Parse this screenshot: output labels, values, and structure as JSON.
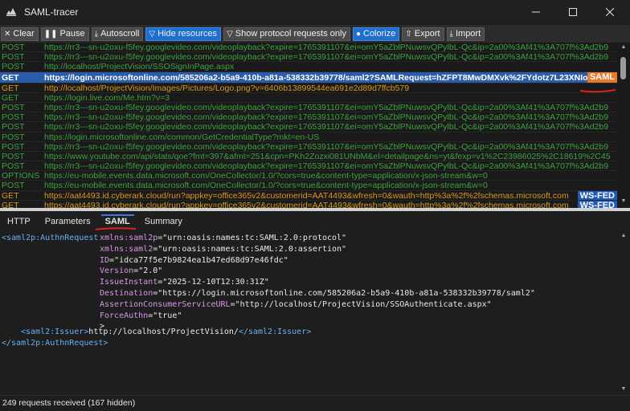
{
  "window": {
    "title": "SAML-tracer",
    "controls": {
      "minimize": "—",
      "maximize": "☐",
      "close": "✕"
    }
  },
  "toolbar": {
    "clear": "Clear",
    "pause": "Pause",
    "autoscroll": "Autoscroll",
    "hide_resources": "Hide resources",
    "show_protocol": "Show protocol requests only",
    "colorize": "Colorize",
    "export": "Export",
    "import": "Import"
  },
  "requests": [
    {
      "method": "POST",
      "url": "https://rr3---sn-u2oxu-f5fey.googlevideo.com/videoplayback?expire=1765391107&ei=omY5aZblPNuwsvQPylbL-Qc&ip=2a00%3Af41%3A707f%3Ad2b9",
      "style": "post"
    },
    {
      "method": "POST",
      "url": "https://rr3---sn-u2oxu-f5fey.googlevideo.com/videoplayback?expire=1765391107&ei=omY5aZblPNuwsvQPylbL-Qc&ip=2a00%3Af41%3A707f%3Ad2b9",
      "style": "post"
    },
    {
      "method": "POST",
      "url": "http://localhost/ProjectVision/SSOSignInPage.aspx",
      "style": "post"
    },
    {
      "method": "GET",
      "url": "https://login.microsoftonline.com/585206a2-b5a9-410b-a81a-538332b39778/saml2?SAMLRequest=hZFPT8MwDMXvk%2FYdotz7L23XNIonTU",
      "style": "sel",
      "tag": "SAML"
    },
    {
      "method": "GET",
      "url": "http://localhost/ProjectVision/Images/Pictures/Logo.png?v=6406b13899544ea691e2d89d7ffcb579",
      "style": "get-orange"
    },
    {
      "method": "GET",
      "url": "https://login.live.com/Me.htm?v=3",
      "style": "get-green"
    },
    {
      "method": "POST",
      "url": "https://rr3---sn-u2oxu-f5fey.googlevideo.com/videoplayback?expire=1765391107&ei=omY5aZblPNuwsvQPylbL-Qc&ip=2a00%3Af41%3A707f%3Ad2b9",
      "style": "post"
    },
    {
      "method": "POST",
      "url": "https://rr3---sn-u2oxu-f5fey.googlevideo.com/videoplayback?expire=1765391107&ei=omY5aZblPNuwsvQPylbL-Qc&ip=2a00%3Af41%3A707f%3Ad2b9",
      "style": "post"
    },
    {
      "method": "POST",
      "url": "https://rr3---sn-u2oxu-f5fey.googlevideo.com/videoplayback?expire=1765391107&ei=omY5aZblPNuwsvQPylbL-Qc&ip=2a00%3Af41%3A707f%3Ad2b9",
      "style": "post"
    },
    {
      "method": "POST",
      "url": "https://login.microsoftonline.com/common/GetCredentialType?mkt=en-US",
      "style": "post"
    },
    {
      "method": "POST",
      "url": "https://rr3---sn-u2oxu-f5fey.googlevideo.com/videoplayback?expire=1765391107&ei=omY5aZblPNuwsvQPylbL-Qc&ip=2a00%3Af41%3A707f%3Ad2b9",
      "style": "post"
    },
    {
      "method": "POST",
      "url": "https://www.youtube.com/api/stats/qoe?fmt=397&afmt=251&cpn=PKh2Zozxi081UNbM&el=detailpage&ns=yt&fexp=v1%2C23986025%2C18619%2C45",
      "style": "post"
    },
    {
      "method": "POST",
      "url": "https://rr3---sn-u2oxu-f5fey.googlevideo.com/videoplayback?expire=1765391107&ei=omY5aZblPNuwsvQPylbL-Qc&ip=2a00%3Af41%3A707f%3Ad2b9",
      "style": "post"
    },
    {
      "method": "OPTIONS",
      "url": "https://eu-mobile.events.data.microsoft.com/OneCollector/1.0/?cors=true&content-type=application/x-json-stream&w=0",
      "style": "opt"
    },
    {
      "method": "POST",
      "url": "https://eu-mobile.events.data.microsoft.com/OneCollector/1.0/?cors=true&content-type=application/x-json-stream&w=0",
      "style": "post"
    },
    {
      "method": "GET",
      "url": "https://aat4493.id.cyberark.cloud/run?appkey=office365v2&customerid=AAT4493&wfresh=0&wauth=http%3a%2f%2fschemas.microsoft.com",
      "style": "get-orange",
      "tag": "WS-FED"
    },
    {
      "method": "GET",
      "url": "https://aat4493.id.cyberark.cloud/run?appkey=office365v2&customerid=AAT4493&wfresh=0&wauth=http%3a%2f%2fschemas.microsoft.com",
      "style": "get-orange",
      "tag": "WS-FED"
    }
  ],
  "tabs": {
    "http": "HTTP",
    "parameters": "Parameters",
    "saml": "SAML",
    "summary": "Summary"
  },
  "xml": {
    "open_tag": "<saml2p:AuthnRequest",
    "attrs": [
      {
        "name": "xmlns:saml2p",
        "value": "\"urn:oasis:names:tc:SAML:2.0:protocol\""
      },
      {
        "name": "xmlns:saml2",
        "value": "\"urn:oasis:names:tc:SAML:2.0:assertion\""
      },
      {
        "name": "ID",
        "value": "\"idca77f5e7b9824ea1b47ed68d97e46fdc\""
      },
      {
        "name": "Version",
        "value": "\"2.0\""
      },
      {
        "name": "IssueInstant",
        "value": "\"2025-12-10T12:30:31Z\""
      },
      {
        "name": "Destination",
        "value": "\"https://login.microsoftonline.com/585206a2-b5a9-410b-a81a-538332b39778/saml2\""
      },
      {
        "name": "AssertionConsumerServiceURL",
        "value": "\"http://localhost/ProjectVision/SSOAuthenticate.aspx\""
      },
      {
        "name": "ForceAuthn",
        "value": "\"true\""
      }
    ],
    "close_bracket": ">",
    "issuer_open": "<saml2:Issuer>",
    "issuer_value": "http://localhost/ProjectVision/",
    "issuer_close": "</saml2:Issuer>",
    "close_tag": "</saml2p:AuthnRequest>"
  },
  "status": "249 requests received (167 hidden)"
}
